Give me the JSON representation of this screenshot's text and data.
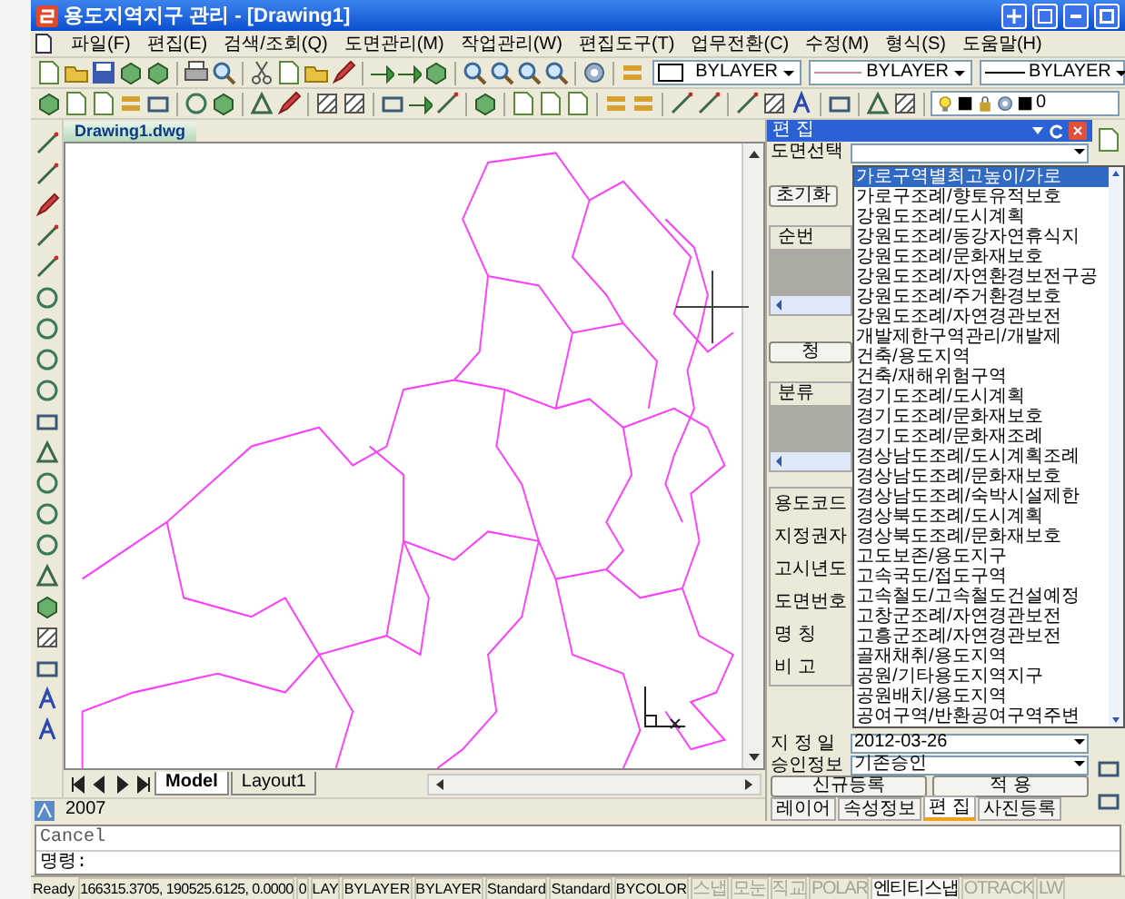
{
  "window": {
    "title": "용도지역지구 관리 - [Drawing1]"
  },
  "menu": [
    "파일(F)",
    "편집(E)",
    "검색/조회(Q)",
    "도면관리(M)",
    "작업관리(W)",
    "편집도구(T)",
    "업무전환(C)",
    "수정(M)",
    "형식(S)",
    "도움말(H)"
  ],
  "toolbar": {
    "color_combo": "BYLAYER",
    "linetype": "BYLAYER",
    "lineweight": "BYLAYER",
    "layer": "0"
  },
  "document_tab": "Drawing1.dwg",
  "layout_tabs": [
    {
      "label": "Model",
      "selected": true
    },
    {
      "label": "Layout1",
      "selected": false
    }
  ],
  "panel": {
    "title": "편 집",
    "drawing_select_label": "도면선택",
    "reset_button": "초기화",
    "grid_1_header": "순번",
    "button_2": "청",
    "grid_2_header": "분류",
    "field_labels": [
      "용도코드",
      "지정권자",
      "고시년도",
      "도면번호",
      "명 칭",
      "비 고"
    ],
    "date_label": "지 정 일",
    "date_value": "2012-03-26",
    "approval_label": "승인정보",
    "approval_value": "기존승인",
    "buttons": [
      "신규등록",
      "적 용"
    ],
    "tabs": [
      {
        "label": "레이어",
        "selected": false
      },
      {
        "label": "속성정보",
        "selected": false
      },
      {
        "label": "편 집",
        "selected": true
      },
      {
        "label": "사진등록",
        "selected": false
      }
    ],
    "dropdown_options": [
      {
        "label": "가로구역별최고높이/가로",
        "selected": true
      },
      {
        "label": "가로구조례/향토유적보호",
        "selected": false
      },
      {
        "label": "강원도조례/도시계획",
        "selected": false
      },
      {
        "label": "강원도조례/동강자연휴식지",
        "selected": false
      },
      {
        "label": "강원도조례/문화재보호",
        "selected": false
      },
      {
        "label": "강원도조례/자연환경보전구공",
        "selected": false
      },
      {
        "label": "강원도조례/주거환경보호",
        "selected": false
      },
      {
        "label": "강원도조례/자연경관보전",
        "selected": false
      },
      {
        "label": "개발제한구역관리/개발제",
        "selected": false
      },
      {
        "label": "건축/용도지역",
        "selected": false
      },
      {
        "label": "건축/재해위험구역",
        "selected": false
      },
      {
        "label": "경기도조례/도시계획",
        "selected": false
      },
      {
        "label": "경기도조례/문화재보호",
        "selected": false
      },
      {
        "label": "경기도조례/문화재조례",
        "selected": false
      },
      {
        "label": "경상남도조례/도시계획조례",
        "selected": false
      },
      {
        "label": "경상남도조례/문화재보호",
        "selected": false
      },
      {
        "label": "경상남도조례/숙박시설제한",
        "selected": false
      },
      {
        "label": "경상북도조례/도시계획",
        "selected": false
      },
      {
        "label": "경상북도조례/문화재보호",
        "selected": false
      },
      {
        "label": "고도보존/용도지구",
        "selected": false
      },
      {
        "label": "고속국도/접도구역",
        "selected": false
      },
      {
        "label": "고속철도/고속철도건설예정",
        "selected": false
      },
      {
        "label": "고창군조례/자연경관보전",
        "selected": false
      },
      {
        "label": "고흥군조례/자연경관보전",
        "selected": false
      },
      {
        "label": "골재채취/용도지역",
        "selected": false
      },
      {
        "label": "공원/기타용도지역지구",
        "selected": false
      },
      {
        "label": "공원배치/용도지역",
        "selected": false
      },
      {
        "label": "공여구역/반환공여구역주변",
        "selected": false
      }
    ]
  },
  "version_label": "2007",
  "command_lines": [
    "Cancel",
    "명령:"
  ],
  "status_bar": {
    "message": "Ready",
    "coordinates": "166315.3705, 190525.6125, 0.0000",
    "fields": [
      "0",
      "LAY",
      "BYLAYER",
      "BYLAYER",
      "Standard",
      "Standard",
      "BYCOLOR"
    ],
    "toggles": [
      {
        "label": "스냅",
        "on": false
      },
      {
        "label": "모눈",
        "on": false
      },
      {
        "label": "직교",
        "on": false
      },
      {
        "label": "POLAR",
        "on": false
      },
      {
        "label": "엔티티스냅",
        "on": true
      },
      {
        "label": "OTRACK",
        "on": false
      },
      {
        "label": "LW",
        "on": false
      }
    ]
  }
}
